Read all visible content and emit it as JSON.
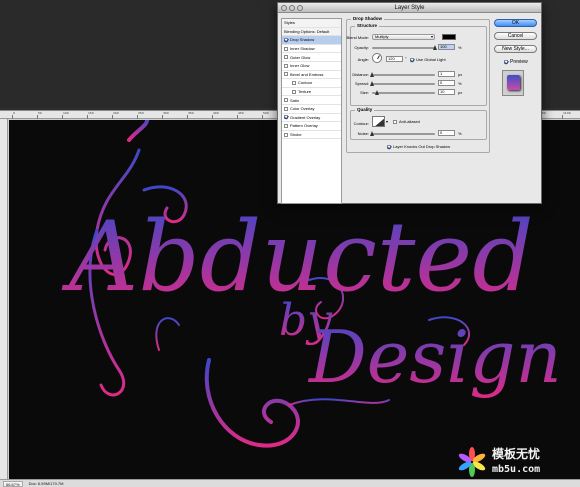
{
  "dialog": {
    "title": "Layer Style",
    "styles_list": [
      {
        "label": "Styles",
        "type": "header"
      },
      {
        "label": "Blending Options: Default",
        "type": "header"
      },
      {
        "label": "Drop Shadow",
        "checked": true,
        "selected": true
      },
      {
        "label": "Inner Shadow",
        "checked": false
      },
      {
        "label": "Outer Glow",
        "checked": false
      },
      {
        "label": "Inner Glow",
        "checked": false
      },
      {
        "label": "Bevel and Emboss",
        "checked": false
      },
      {
        "label": "Contour",
        "checked": false,
        "indent": true
      },
      {
        "label": "Texture",
        "checked": false,
        "indent": true
      },
      {
        "label": "Satin",
        "checked": false
      },
      {
        "label": "Color Overlay",
        "checked": false
      },
      {
        "label": "Gradient Overlay",
        "checked": true
      },
      {
        "label": "Pattern Overlay",
        "checked": false
      },
      {
        "label": "Stroke",
        "checked": false
      }
    ],
    "drop_shadow": {
      "title": "Drop Shadow",
      "structure_title": "Structure",
      "blend_mode_label": "Blend Mode:",
      "blend_mode_value": "Multiply",
      "shadow_color": "#000000",
      "opacity_label": "Opacity:",
      "opacity_value": "100",
      "opacity_level": 1.0,
      "percent": "%",
      "angle_label": "Angle:",
      "angle_value": "120",
      "degree": "°",
      "global_light_label": "Use Global Light",
      "distance_label": "Distance:",
      "distance_value": "1",
      "spread_label": "Spread:",
      "spread_value": "0",
      "size_label": "Size:",
      "size_value": "10",
      "px": "px",
      "quality_title": "Quality",
      "contour_label": "Contour:",
      "anti_aliased_label": "Anti-aliased",
      "noise_label": "Noise:",
      "noise_value": "0",
      "knockout_label": "Layer Knocks Out Drop Shadow"
    },
    "buttons": {
      "ok": "OK",
      "cancel": "Cancel",
      "new_style": "New Style...",
      "preview": "Preview"
    }
  },
  "canvas_art": {
    "line1": "Abducted",
    "line2": "by",
    "line3": "Design",
    "gradient_top": "#3e48c8",
    "gradient_bottom": "#e02a86"
  },
  "status": {
    "zoom": "66.67%",
    "doc": "Doc: 6.59M/170.7M"
  },
  "ruler_labels": [
    "0",
    "50",
    "100",
    "150",
    "200",
    "250",
    "300",
    "350",
    "400",
    "450",
    "500",
    "550",
    "600",
    "650",
    "700",
    "750",
    "800",
    "850",
    "900",
    "950",
    "1000",
    "1050",
    "1100"
  ],
  "watermark": {
    "line1": "模板无忧",
    "line2": "mb5u.com",
    "colors": [
      "#ff4f4f",
      "#ffb23a",
      "#f7e646",
      "#4ecc5a",
      "#3aa0ff",
      "#b45cff"
    ]
  }
}
